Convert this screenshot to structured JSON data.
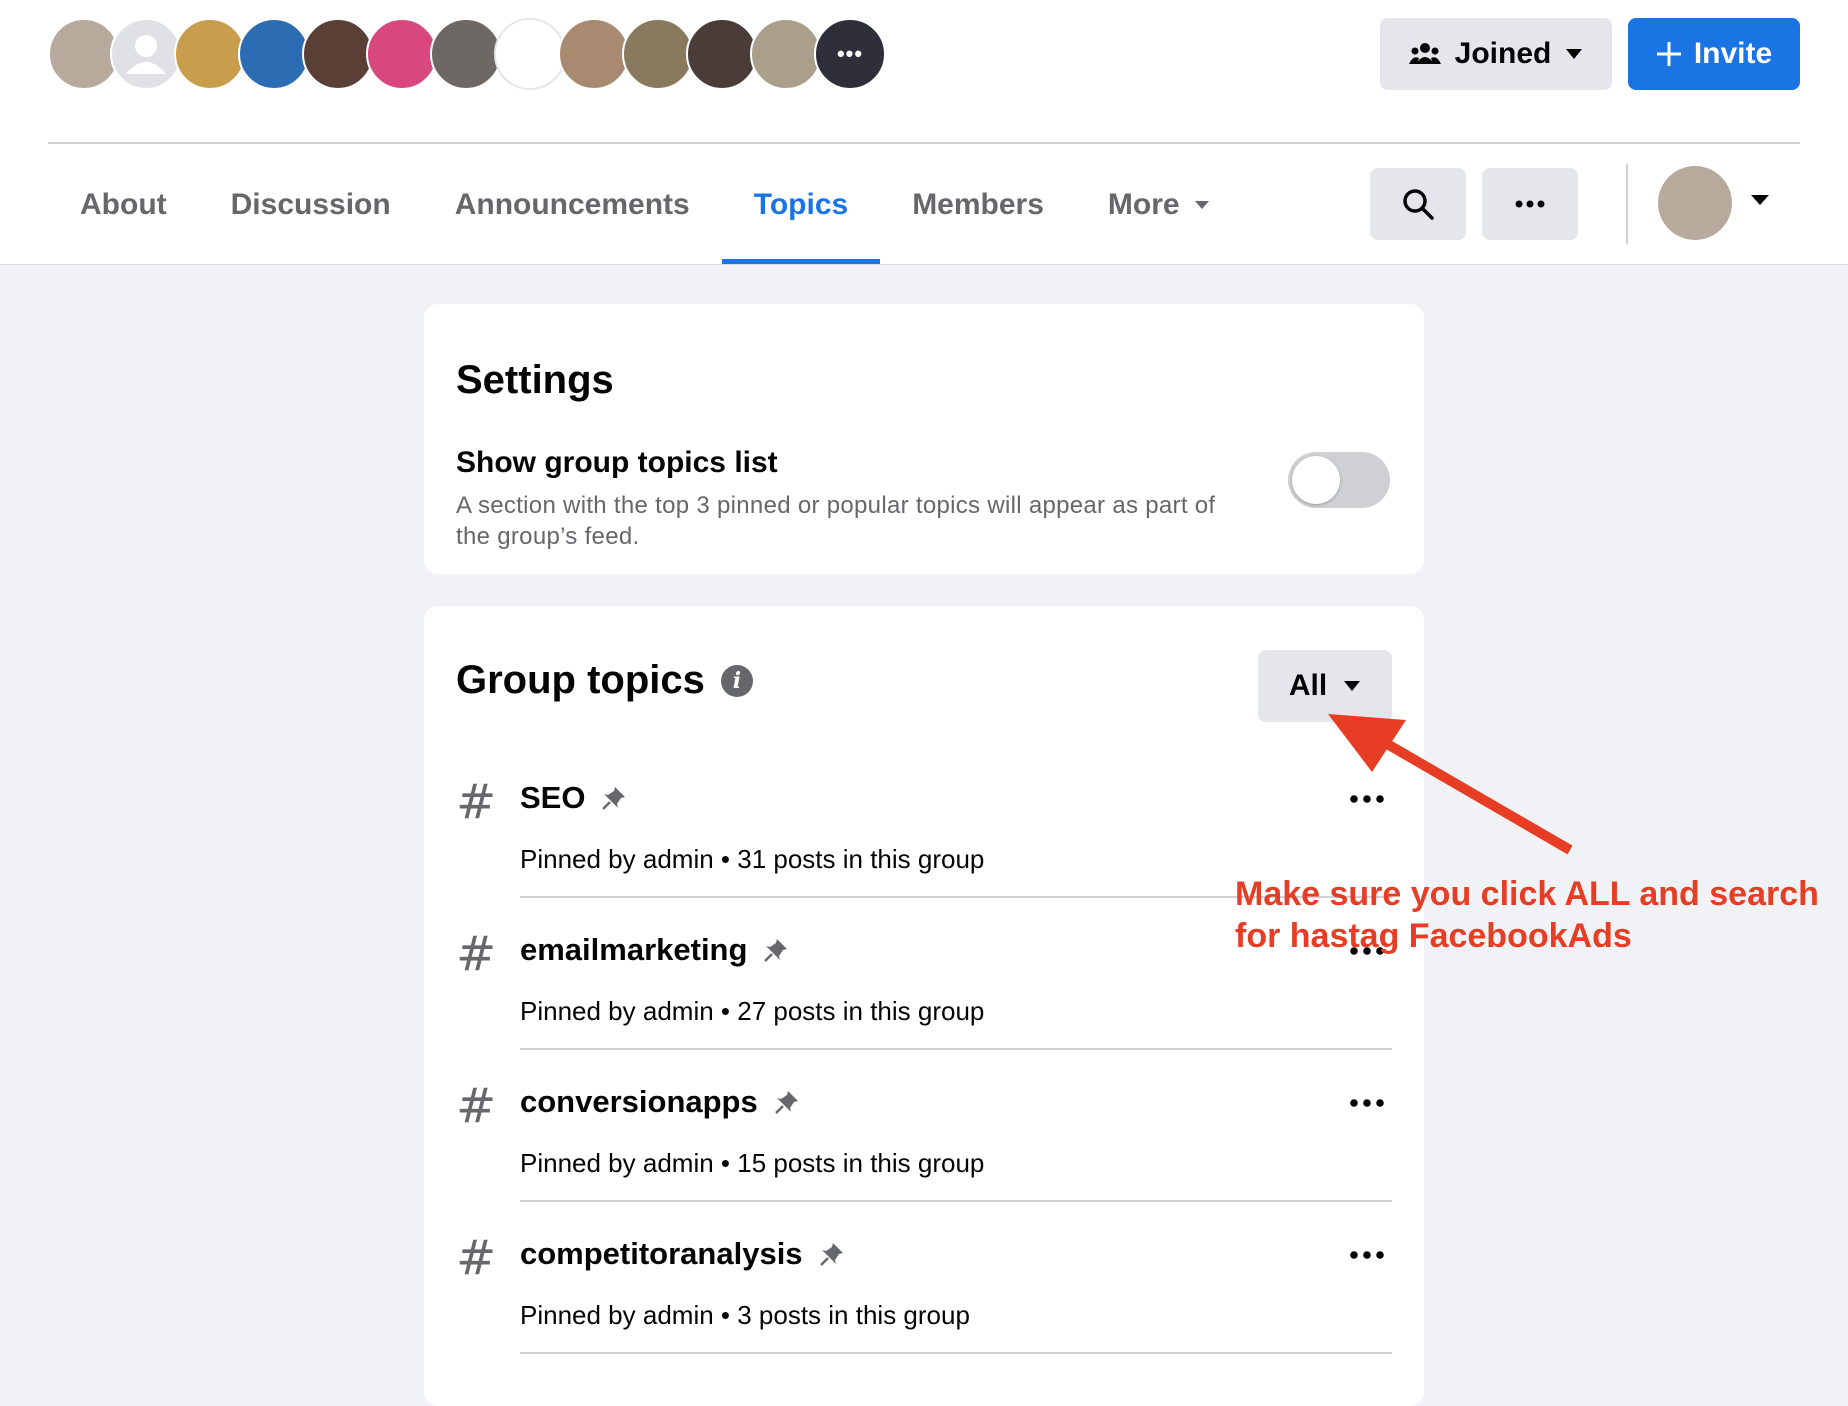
{
  "header": {
    "avatar_count": 13,
    "avatar_colors": [
      "#b7a99c",
      "#c7c9cd",
      "#c89d4b",
      "#2c6cb3",
      "#5a3f37",
      "#d8487c",
      "#6e6864",
      "#ffffff",
      "#a88a70",
      "#8a7a5d",
      "#4a3d39",
      "#a99f8a",
      "#2e2f3a"
    ],
    "joined_label": "Joined",
    "invite_label": "Invite",
    "accent_color": "#1b74e4"
  },
  "tabs": [
    {
      "label": "About"
    },
    {
      "label": "Discussion"
    },
    {
      "label": "Announcements"
    },
    {
      "label": "Topics"
    },
    {
      "label": "Members"
    },
    {
      "label": "More"
    }
  ],
  "settings": {
    "title": "Settings",
    "toggle_title": "Show group topics list",
    "toggle_description": "A section with the top 3 pinned or popular topics will appear as part of the group’s feed.",
    "toggle_on": false
  },
  "group_topics": {
    "title": "Group topics",
    "filter_label": "All",
    "items": [
      {
        "name": "SEO",
        "meta": "Pinned by admin • 31 posts in this group"
      },
      {
        "name": "emailmarketing",
        "meta": "Pinned by admin • 27 posts in this group"
      },
      {
        "name": "conversionapps",
        "meta": "Pinned by admin • 15 posts in this group"
      },
      {
        "name": "competitoranalysis",
        "meta": "Pinned by admin • 3 posts in this group"
      }
    ]
  },
  "annotation": {
    "text": "Make sure you click ALL and search for hastag FacebookAds",
    "color": "#e63d24"
  }
}
